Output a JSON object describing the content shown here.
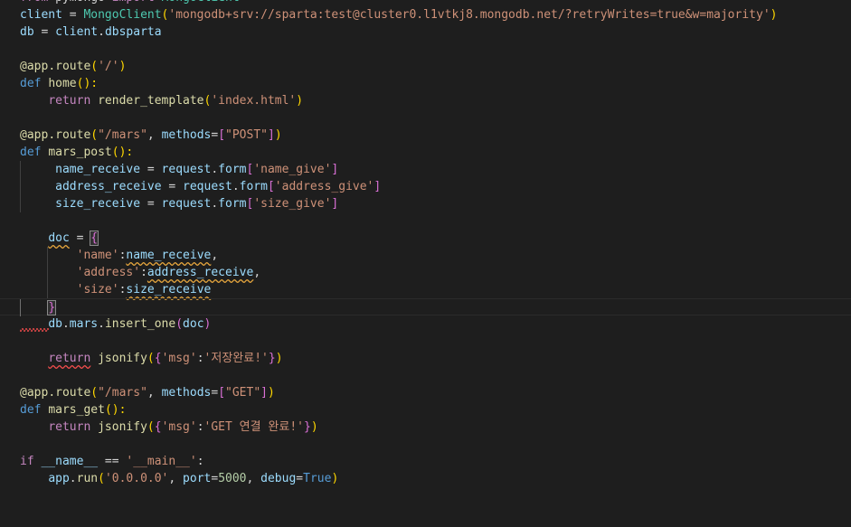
{
  "editor": {
    "theme_background": "#1e1e1e",
    "lines": [
      [
        [
          "from",
          "ctl"
        ],
        [
          " pymongo ",
          "plain"
        ],
        [
          "import",
          "ctl"
        ],
        [
          " MongoClient",
          "cls"
        ]
      ],
      [
        [
          "client",
          "var"
        ],
        [
          " = ",
          "plain"
        ],
        [
          "MongoClient",
          "cls"
        ],
        [
          "(",
          "b1"
        ],
        [
          "'mongodb+srv://sparta:test@cluster0.l1vtkj8.mongodb.net/?retryWrites=true&w=majority'",
          "str"
        ],
        [
          ")",
          "b1"
        ]
      ],
      [
        [
          "db",
          "var"
        ],
        [
          " = ",
          "plain"
        ],
        [
          "client",
          "var"
        ],
        [
          ".",
          "plain"
        ],
        [
          "dbsparta",
          "var"
        ]
      ],
      [],
      [
        [
          "@",
          "dec"
        ],
        [
          "app",
          "dec"
        ],
        [
          ".",
          "dec"
        ],
        [
          "route",
          "dec"
        ],
        [
          "(",
          "b1"
        ],
        [
          "'/'",
          "str"
        ],
        [
          ")",
          "b1"
        ]
      ],
      [
        [
          "def",
          "kw"
        ],
        [
          " ",
          "plain"
        ],
        [
          "home",
          "fn"
        ],
        [
          "():",
          "b1"
        ]
      ],
      [
        [
          "    ",
          "plain"
        ],
        [
          "return",
          "ctl"
        ],
        [
          " ",
          "plain"
        ],
        [
          "render_template",
          "fn"
        ],
        [
          "(",
          "b1"
        ],
        [
          "'index.html'",
          "str"
        ],
        [
          ")",
          "b1"
        ]
      ],
      [],
      [
        [
          "@",
          "dec"
        ],
        [
          "app",
          "dec"
        ],
        [
          ".",
          "dec"
        ],
        [
          "route",
          "dec"
        ],
        [
          "(",
          "b1"
        ],
        [
          "\"/mars\"",
          "str"
        ],
        [
          ", ",
          "plain"
        ],
        [
          "methods",
          "var"
        ],
        [
          "=",
          "plain"
        ],
        [
          "[",
          "b2"
        ],
        [
          "\"POST\"",
          "str"
        ],
        [
          "]",
          "b2"
        ],
        [
          ")",
          "b1"
        ]
      ],
      [
        [
          "def",
          "kw"
        ],
        [
          " ",
          "plain"
        ],
        [
          "mars_post",
          "fn"
        ],
        [
          "():",
          "b1"
        ]
      ],
      [
        [
          "     ",
          "plain"
        ],
        [
          "name_receive",
          "var"
        ],
        [
          " = ",
          "plain"
        ],
        [
          "request",
          "var"
        ],
        [
          ".",
          "plain"
        ],
        [
          "form",
          "var"
        ],
        [
          "[",
          "b2"
        ],
        [
          "'name_give'",
          "str"
        ],
        [
          "]",
          "b2"
        ]
      ],
      [
        [
          "     ",
          "plain"
        ],
        [
          "address_receive",
          "var"
        ],
        [
          " = ",
          "plain"
        ],
        [
          "request",
          "var"
        ],
        [
          ".",
          "plain"
        ],
        [
          "form",
          "var"
        ],
        [
          "[",
          "b2"
        ],
        [
          "'address_give'",
          "str"
        ],
        [
          "]",
          "b2"
        ]
      ],
      [
        [
          "     ",
          "plain"
        ],
        [
          "size_receive",
          "var"
        ],
        [
          " = ",
          "plain"
        ],
        [
          "request",
          "var"
        ],
        [
          ".",
          "plain"
        ],
        [
          "form",
          "var"
        ],
        [
          "[",
          "b2"
        ],
        [
          "'size_give'",
          "str"
        ],
        [
          "]",
          "b2"
        ]
      ],
      [],
      [
        [
          "    ",
          "plain"
        ],
        [
          "doc",
          "var warn"
        ],
        [
          " = ",
          "plain"
        ],
        [
          "{",
          "b2 bracket-match"
        ]
      ],
      [
        [
          "        ",
          "plain"
        ],
        [
          "'name'",
          "str"
        ],
        [
          ":",
          "plain"
        ],
        [
          "name_receive",
          "var warn"
        ],
        [
          ",",
          "plain"
        ]
      ],
      [
        [
          "        ",
          "plain"
        ],
        [
          "'address'",
          "str"
        ],
        [
          ":",
          "plain"
        ],
        [
          "address_receive",
          "var warn"
        ],
        [
          ",",
          "plain"
        ]
      ],
      [
        [
          "        ",
          "plain"
        ],
        [
          "'size'",
          "str"
        ],
        [
          ":",
          "plain"
        ],
        [
          "size_receive",
          "var warn"
        ]
      ],
      [
        [
          "    ",
          "plain"
        ],
        [
          "}",
          "b2 bracket-match"
        ]
      ],
      [
        [
          "    ",
          "plain"
        ],
        [
          "db",
          "var"
        ],
        [
          ".",
          "plain"
        ],
        [
          "mars",
          "var"
        ],
        [
          ".",
          "plain"
        ],
        [
          "insert_one",
          "fn"
        ],
        [
          "(",
          "b2"
        ],
        [
          "doc",
          "var"
        ],
        [
          ")",
          "b2"
        ]
      ],
      [],
      [
        [
          "    ",
          "plain"
        ],
        [
          "return",
          "ctl err"
        ],
        [
          " ",
          "plain"
        ],
        [
          "jsonify",
          "fn"
        ],
        [
          "(",
          "b1"
        ],
        [
          "{",
          "b2"
        ],
        [
          "'msg'",
          "str"
        ],
        [
          ":",
          "plain"
        ],
        [
          "'저장완료!'",
          "str"
        ],
        [
          "}",
          "b2"
        ],
        [
          ")",
          "b1"
        ]
      ],
      [],
      [
        [
          "@",
          "dec"
        ],
        [
          "app",
          "dec"
        ],
        [
          ".",
          "dec"
        ],
        [
          "route",
          "dec"
        ],
        [
          "(",
          "b1"
        ],
        [
          "\"/mars\"",
          "str"
        ],
        [
          ", ",
          "plain"
        ],
        [
          "methods",
          "var"
        ],
        [
          "=",
          "plain"
        ],
        [
          "[",
          "b2"
        ],
        [
          "\"GET\"",
          "str"
        ],
        [
          "]",
          "b2"
        ],
        [
          ")",
          "b1"
        ]
      ],
      [
        [
          "def",
          "kw"
        ],
        [
          " ",
          "plain"
        ],
        [
          "mars_get",
          "fn"
        ],
        [
          "():",
          "b1"
        ]
      ],
      [
        [
          "    ",
          "plain"
        ],
        [
          "return",
          "ctl"
        ],
        [
          " ",
          "plain"
        ],
        [
          "jsonify",
          "fn"
        ],
        [
          "(",
          "b1"
        ],
        [
          "{",
          "b2"
        ],
        [
          "'msg'",
          "str"
        ],
        [
          ":",
          "plain"
        ],
        [
          "'GET 연결 완료!'",
          "str"
        ],
        [
          "}",
          "b2"
        ],
        [
          ")",
          "b1"
        ]
      ],
      [],
      [
        [
          "if",
          "ctl"
        ],
        [
          " ",
          "plain"
        ],
        [
          "__name__",
          "var"
        ],
        [
          " == ",
          "plain"
        ],
        [
          "'__main__'",
          "str"
        ],
        [
          ":",
          "plain"
        ]
      ],
      [
        [
          "    ",
          "plain"
        ],
        [
          "app",
          "var"
        ],
        [
          ".",
          "plain"
        ],
        [
          "run",
          "fn"
        ],
        [
          "(",
          "b1"
        ],
        [
          "'0.0.0.0'",
          "str"
        ],
        [
          ", ",
          "plain"
        ],
        [
          "port",
          "var"
        ],
        [
          "=",
          "plain"
        ],
        [
          "5000",
          "num"
        ],
        [
          ", ",
          "plain"
        ],
        [
          "debug",
          "var"
        ],
        [
          "=",
          "plain"
        ],
        [
          "True",
          "kw"
        ],
        [
          ")",
          "b1"
        ]
      ],
      []
    ]
  }
}
